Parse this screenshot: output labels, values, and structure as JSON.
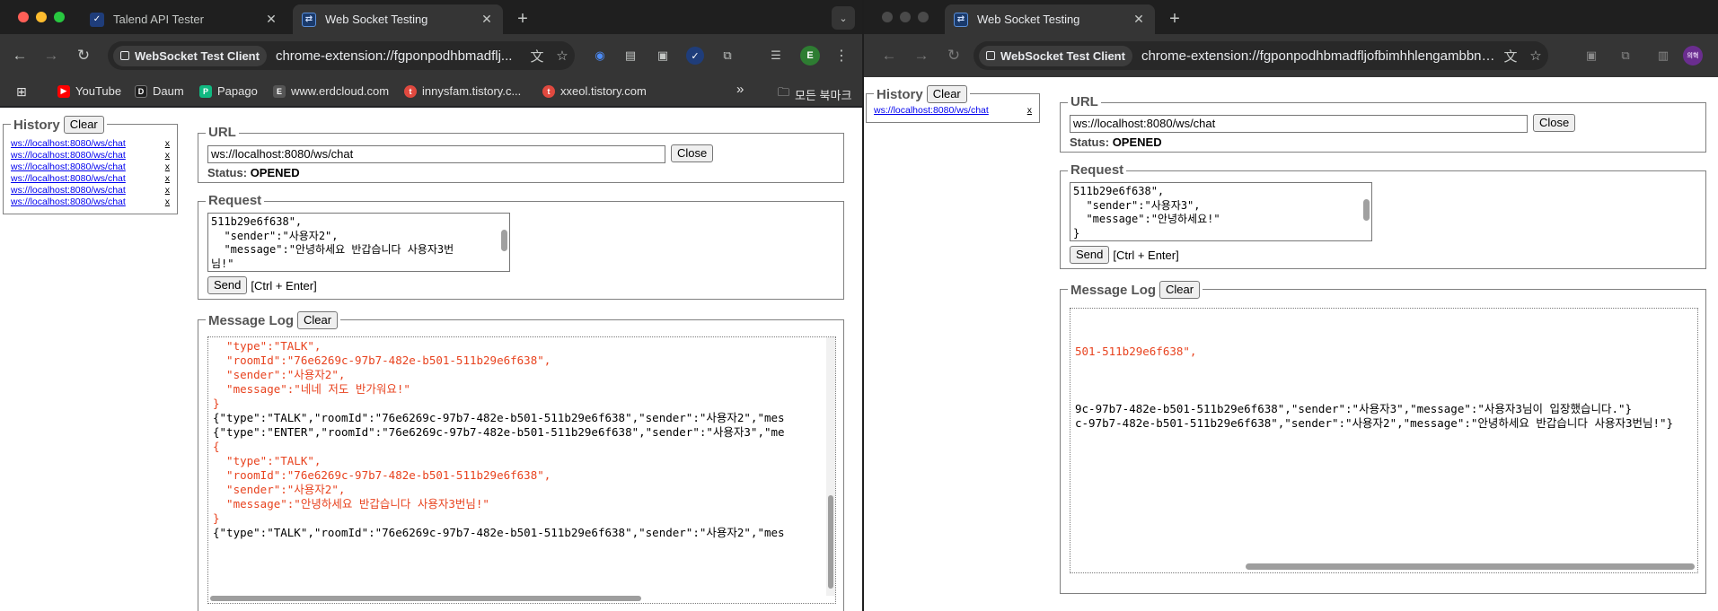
{
  "left": {
    "tabs": [
      {
        "title": "Talend API Tester",
        "icon": "talend-icon",
        "active": false
      },
      {
        "title": "Web Socket Testing",
        "icon": "websocket-icon",
        "active": true
      }
    ],
    "toolbar": {
      "chip_label": "WebSocket Test Client",
      "url": "chrome-extension://fgponpodhbmadflj...",
      "avatar_letter": "E"
    },
    "bookmarks": [
      {
        "label": "YouTube",
        "icon": "youtube-icon",
        "color": "#ff0000"
      },
      {
        "label": "Daum",
        "icon": "daum-icon",
        "color": "#1f1f1f"
      },
      {
        "label": "Papago",
        "icon": "papago-icon",
        "color": "#10b981"
      },
      {
        "label": "www.erdcloud.com",
        "icon": "erd-icon",
        "color": "#555555"
      },
      {
        "label": "innysfam.tistory.c...",
        "icon": "tistory-icon",
        "color": "#e0493f"
      },
      {
        "label": "xxeol.tistory.com",
        "icon": "tistory-icon",
        "color": "#e0493f"
      }
    ],
    "bookmarks_overflow": "»",
    "bookmarks_folder": "모든 북마크",
    "history": {
      "legend": "History",
      "clear": "Clear",
      "items": [
        {
          "url": "ws://localhost:8080/ws/chat",
          "remove": "x"
        },
        {
          "url": "ws://localhost:8080/ws/chat",
          "remove": "x"
        },
        {
          "url": "ws://localhost:8080/ws/chat",
          "remove": "x"
        },
        {
          "url": "ws://localhost:8080/ws/chat",
          "remove": "x"
        },
        {
          "url": "ws://localhost:8080/ws/chat",
          "remove": "x"
        },
        {
          "url": "ws://localhost:8080/ws/chat",
          "remove": "x"
        }
      ]
    },
    "url_section": {
      "legend": "URL",
      "value": "ws://localhost:8080/ws/chat",
      "close": "Close",
      "status_label": "Status:",
      "status_value": "OPENED"
    },
    "request": {
      "legend": "Request",
      "text": "511b29e6f638\",\n  \"sender\":\"사용자2\",\n  \"message\":\"안녕하세요 반갑습니다 사용자3번\n님!\"",
      "send": "Send",
      "hint": "[Ctrl + Enter]"
    },
    "message_log": {
      "legend": "Message Log",
      "clear": "Clear",
      "lines": [
        {
          "text": "  \"type\":\"TALK\",",
          "kind": "sent"
        },
        {
          "text": "  \"roomId\":\"76e6269c-97b7-482e-b501-511b29e6f638\",",
          "kind": "sent"
        },
        {
          "text": "  \"sender\":\"사용자2\",",
          "kind": "sent"
        },
        {
          "text": "  \"message\":\"네네 저도 반가워요!\"",
          "kind": "sent"
        },
        {
          "text": "}",
          "kind": "sent"
        },
        {
          "text": "{\"type\":\"TALK\",\"roomId\":\"76e6269c-97b7-482e-b501-511b29e6f638\",\"sender\":\"사용자2\",\"mes",
          "kind": "recv"
        },
        {
          "text": "{\"type\":\"ENTER\",\"roomId\":\"76e6269c-97b7-482e-b501-511b29e6f638\",\"sender\":\"사용자3\",\"me",
          "kind": "recv"
        },
        {
          "text": "{",
          "kind": "sent"
        },
        {
          "text": "  \"type\":\"TALK\",",
          "kind": "sent"
        },
        {
          "text": "  \"roomId\":\"76e6269c-97b7-482e-b501-511b29e6f638\",",
          "kind": "sent"
        },
        {
          "text": "  \"sender\":\"사용자2\",",
          "kind": "sent"
        },
        {
          "text": "  \"message\":\"안녕하세요 반갑습니다 사용자3번님!\"",
          "kind": "sent"
        },
        {
          "text": "}",
          "kind": "sent"
        },
        {
          "text": "{\"type\":\"TALK\",\"roomId\":\"76e6269c-97b7-482e-b501-511b29e6f638\",\"sender\":\"사용자2\",\"mes",
          "kind": "recv"
        }
      ]
    }
  },
  "right": {
    "tabs": [
      {
        "title": "Web Socket Testing",
        "icon": "websocket-icon",
        "active": true
      }
    ],
    "toolbar": {
      "chip_label": "WebSocket Test Client",
      "url": "chrome-extension://fgponpodhbmadfljofbimhhlengambbn/in...",
      "avatar_letter": "의혁"
    },
    "history": {
      "legend": "History",
      "clear": "Clear",
      "items": [
        {
          "url": "ws://localhost:8080/ws/chat",
          "remove": "x"
        }
      ]
    },
    "url_section": {
      "legend": "URL",
      "value": "ws://localhost:8080/ws/chat",
      "close": "Close",
      "status_label": "Status:",
      "status_value": "OPENED"
    },
    "request": {
      "legend": "Request",
      "text": "511b29e6f638\",\n  \"sender\":\"사용자3\",\n  \"message\":\"안녕하세요!\"\n}",
      "send": "Send",
      "hint": "[Ctrl + Enter]"
    },
    "message_log": {
      "legend": "Message Log",
      "clear": "Clear",
      "lines": [
        {
          "text": "501-511b29e6f638\",",
          "kind": "sent",
          "row": 2
        },
        {
          "text": "9c-97b7-482e-b501-511b29e6f638\",\"sender\":\"사용자3\",\"message\":\"사용자3님이 입장했습니다.\"}",
          "kind": "recv",
          "row": 6
        },
        {
          "text": "c-97b7-482e-b501-511b29e6f638\",\"sender\":\"사용자2\",\"message\":\"안녕하세요 반갑습니다 사용자3번님!\"}",
          "kind": "recv",
          "row": 7
        }
      ]
    }
  }
}
